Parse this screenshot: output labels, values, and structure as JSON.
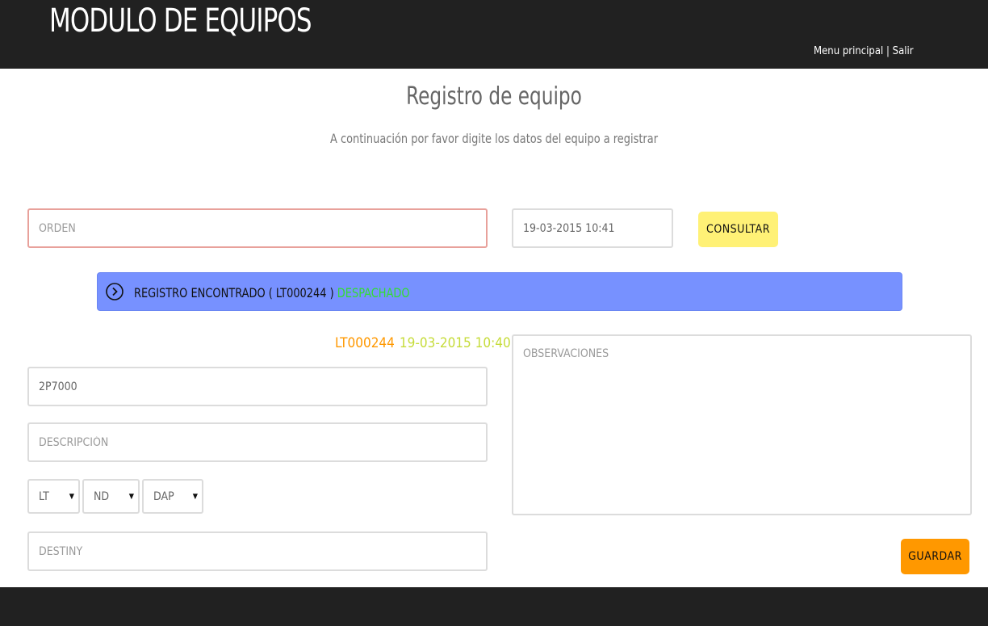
{
  "header": {
    "title": "MODULO DE EQUIPOS",
    "nav_menu": "Menu principal",
    "nav_separator": " | ",
    "nav_logout": "Salir"
  },
  "page": {
    "title": "Registro de equipo",
    "subtitle": "A continuación por favor digite los datos del equipo a registrar"
  },
  "search": {
    "orden_placeholder": "ORDEN",
    "orden_value": "",
    "datetime_value": "19-03-2015 10:41",
    "consult_label": "CONSULTAR"
  },
  "alert": {
    "icon": "chevron-right-circle-icon",
    "message": "REGISTRO ENCONTRADO ( LT000244 ) ",
    "status": "DESPACHADO"
  },
  "record": {
    "code": "LT000244",
    "date": "19-03-2015 10:40"
  },
  "form": {
    "model_value": "2P7000",
    "description_placeholder": "DESCRIPCIÓN",
    "select_1": "LT",
    "select_2": "ND",
    "select_3": "DAP",
    "destiny_placeholder": "DESTINY",
    "observations_placeholder": "OBSERVACIONES",
    "save_label": "GUARDAR"
  },
  "colors": {
    "topbar": "#212121",
    "consult_button": "#fff176",
    "save_button": "#ff9800",
    "alert_bg": "#7791ff",
    "status_green": "#33dd33",
    "record_code": "#ff9800",
    "record_date": "#c6dc3a"
  }
}
